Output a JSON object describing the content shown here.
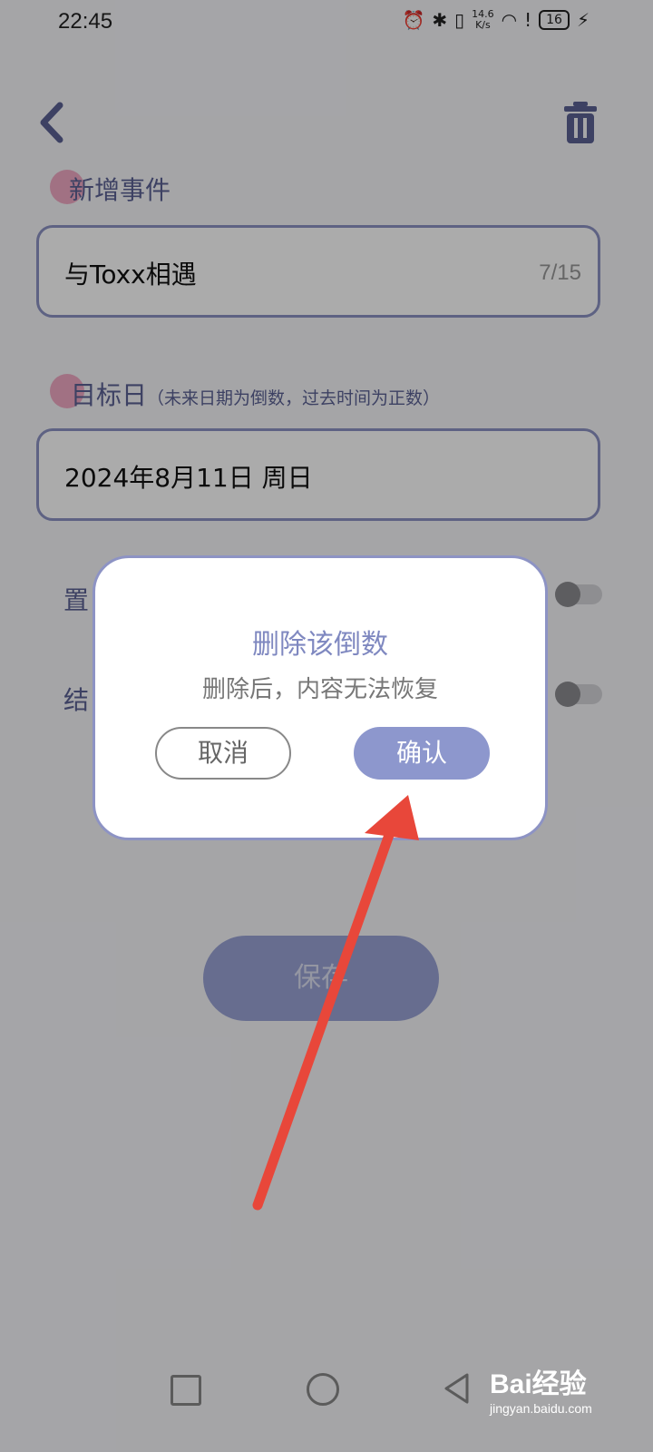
{
  "status_bar": {
    "time": "22:45",
    "speed_value": "14.6",
    "speed_unit": "K/s",
    "battery": "16",
    "icons": [
      "alarm-icon",
      "bluetooth-icon",
      "vibrate-icon",
      "wifi-icon",
      "alert-icon",
      "battery-icon",
      "charging-icon"
    ]
  },
  "header": {
    "back_icon": "chevron-left-icon",
    "delete_icon": "trash-icon"
  },
  "form": {
    "name_label": "新增事件",
    "name_value": "与Toxx相遇",
    "name_count": "7/15",
    "target_label": "目标日",
    "target_hint": "（未来日期为倒数，过去时间为正数）",
    "target_value": "2024年8月11日 周日",
    "pin_label": "置",
    "end_label": "结",
    "save_label": "保存"
  },
  "dialog": {
    "title": "删除该倒数",
    "message": "删除后，内容无法恢复",
    "cancel_label": "取消",
    "confirm_label": "确认"
  },
  "watermark": {
    "main": "Bai经验",
    "sub": "jingyan.baidu.com"
  },
  "colors": {
    "accent": "#8d93c4",
    "label": "#5b6294",
    "confirm": "#8d97cd",
    "arrow": "#e8473a",
    "dot": "#f0a9c3"
  }
}
